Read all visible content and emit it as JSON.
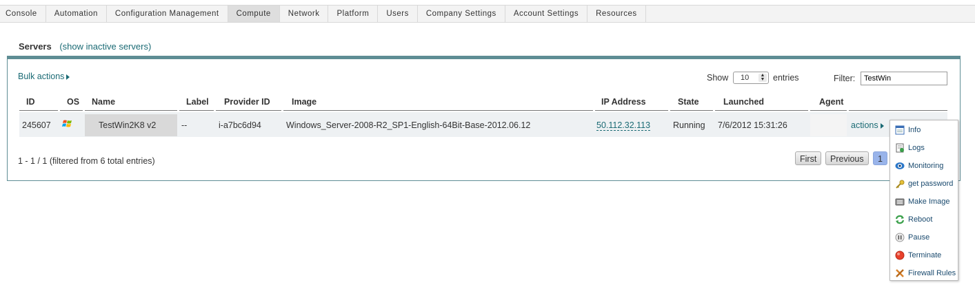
{
  "nav": {
    "tabs": [
      {
        "label": "Console",
        "active": false
      },
      {
        "label": "Automation",
        "active": false
      },
      {
        "label": "Configuration Management",
        "active": false
      },
      {
        "label": "Compute",
        "active": true
      },
      {
        "label": "Network",
        "active": false
      },
      {
        "label": "Platform",
        "active": false
      },
      {
        "label": "Users",
        "active": false
      },
      {
        "label": "Company Settings",
        "active": false
      },
      {
        "label": "Account Settings",
        "active": false
      },
      {
        "label": "Resources",
        "active": false
      }
    ]
  },
  "page": {
    "title": "Servers",
    "inactive_link": "(show inactive servers)"
  },
  "toolbar": {
    "bulk_actions": "Bulk actions",
    "show_label": "Show",
    "entries_value": "10",
    "entries_label": "entries",
    "filter_label": "Filter:",
    "filter_value": "TestWin"
  },
  "table": {
    "columns": [
      "ID",
      "OS",
      "Name",
      "Label",
      "Provider ID",
      "Image",
      "IP Address",
      "State",
      "Launched",
      "Agent"
    ],
    "rows": [
      {
        "id": "245607",
        "os_icon": "windows-logo-icon",
        "name": "TestWin2K8 v2",
        "label": "--",
        "provider_id": "i-a7bc6d94",
        "image": "Windows_Server-2008-R2_SP1-English-64Bit-Base-2012.06.12",
        "ip": "50.112.32.113",
        "state": "Running",
        "launched": "7/6/2012 15:31:26",
        "agent": "",
        "actions": "actions"
      }
    ]
  },
  "footer": {
    "info": "1 - 1 / 1 (filtered from 6 total entries)",
    "first": "First",
    "previous": "Previous",
    "current_page": "1"
  },
  "actions_menu": {
    "items": [
      {
        "label": "Info",
        "icon": "info-icon"
      },
      {
        "label": "Logs",
        "icon": "logs-icon"
      },
      {
        "label": "Monitoring",
        "icon": "monitoring-icon"
      },
      {
        "label": "get password",
        "icon": "key-icon"
      },
      {
        "label": "Make Image",
        "icon": "make-image-icon"
      },
      {
        "label": "Reboot",
        "icon": "reboot-icon"
      },
      {
        "label": "Pause",
        "icon": "pause-icon"
      },
      {
        "label": "Terminate",
        "icon": "terminate-icon"
      },
      {
        "label": "Firewall Rules",
        "icon": "firewall-icon"
      }
    ]
  },
  "colors": {
    "accent": "#1a6a74",
    "panel_border": "#5e8d94",
    "current_page": "#99b4ea"
  }
}
